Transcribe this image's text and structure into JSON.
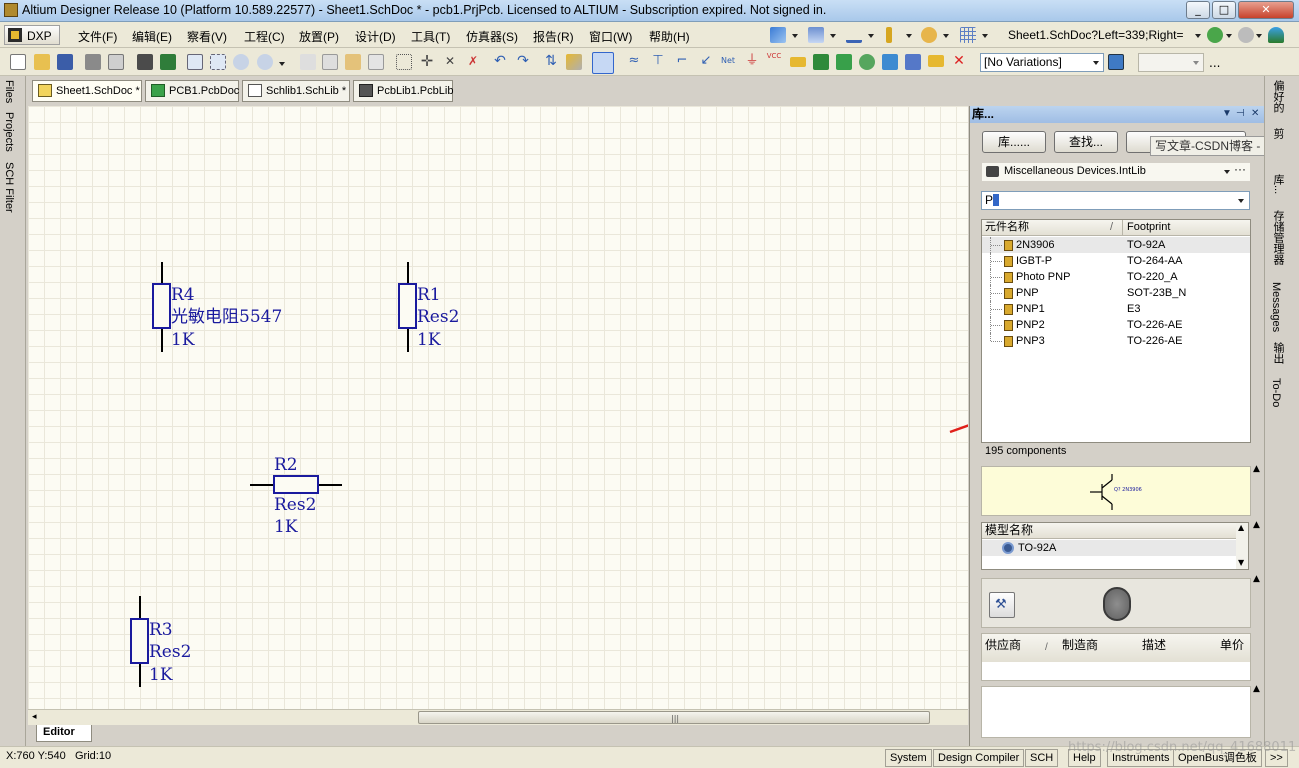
{
  "window": {
    "title": "Altium Designer Release 10 (Platform 10.589.22577) - Sheet1.SchDoc * - pcb1.PrjPcb. Licensed to ALTIUM - Subscription expired. Not signed in.",
    "btn_min": "_",
    "btn_max": "□",
    "btn_close": "✕"
  },
  "menu": {
    "dxp_label": "DXP",
    "items": [
      "文件(F)",
      "编辑(E)",
      "察看(V)",
      "工程(C)",
      "放置(P)",
      "设计(D)",
      "工具(T)",
      "仿真器(S)",
      "报告(R)",
      "窗口(W)",
      "帮助(H)"
    ],
    "doc_locator": "Sheet1.SchDoc?Left=339;Right=",
    "ellipsis": "..."
  },
  "toolbar": {
    "variant_selected": "[No Variations]",
    "ellipsis": "..."
  },
  "left_panels": [
    "Files",
    "Projects",
    "SCH Filter"
  ],
  "doc_tabs": [
    {
      "label": "Sheet1.SchDoc *",
      "kind": "sch"
    },
    {
      "label": "PCB1.PcbDoc",
      "kind": "pcb"
    },
    {
      "label": "Schlib1.SchLib *",
      "kind": "lib"
    },
    {
      "label": "PcbLib1.PcbLib",
      "kind": "pcblib"
    }
  ],
  "schematic": {
    "components": [
      {
        "designator": "R4",
        "comment": "光敏电阻5547",
        "value": "1K"
      },
      {
        "designator": "R1",
        "comment": "Res2",
        "value": "1K"
      },
      {
        "designator": "R2",
        "comment": "Res2",
        "value": "1K"
      },
      {
        "designator": "R3",
        "comment": "Res2",
        "value": "1K"
      }
    ]
  },
  "editor_tab": "Editor",
  "library_panel": {
    "title": "库...",
    "btn_libraries": "库......",
    "btn_search": "查找...",
    "tooltip": "写文章-CSDN博客 - Google",
    "library_selected": "Miscellaneous Devices.IntLib",
    "more": "···",
    "filter_value": "P",
    "columns": {
      "name": "元件名称",
      "footprint": "Footprint",
      "sort_mark": "/"
    },
    "rows": [
      {
        "name": "2N3906",
        "footprint": "TO-92A"
      },
      {
        "name": "IGBT-P",
        "footprint": "TO-264-AA"
      },
      {
        "name": "Photo PNP",
        "footprint": "TO-220_A"
      },
      {
        "name": "PNP",
        "footprint": "SOT-23B_N"
      },
      {
        "name": "PNP1",
        "footprint": "E3"
      },
      {
        "name": "PNP2",
        "footprint": "TO-226-AE"
      },
      {
        "name": "PNP3",
        "footprint": "TO-226-AE"
      }
    ],
    "component_count": "195 components",
    "preview_label": "Q? 2N3906",
    "model_header": "模型名称",
    "model_value": "TO-92A",
    "supplier_cols": {
      "supplier": "供应商",
      "manufacturer": "制造商",
      "description": "描述",
      "unit_price": "单价",
      "sort_mark": "/"
    }
  },
  "right_panels": [
    "偏好的",
    "剪",
    "库...",
    "存储管理器",
    "Messages",
    "输出",
    "To-Do"
  ],
  "status": {
    "coords": "X:760 Y:540",
    "grid": "Grid:10",
    "buttons": [
      "System",
      "Design Compiler",
      "SCH",
      "Help",
      "Instruments",
      "OpenBus调色板",
      ">>"
    ]
  },
  "watermark": "https://blog.csdn.net/qq_41688011",
  "colors": {
    "schematic_blue": "#1a1a9e",
    "canvas_bg": "#fcfbf3",
    "annotation_red": "#e0201a"
  }
}
